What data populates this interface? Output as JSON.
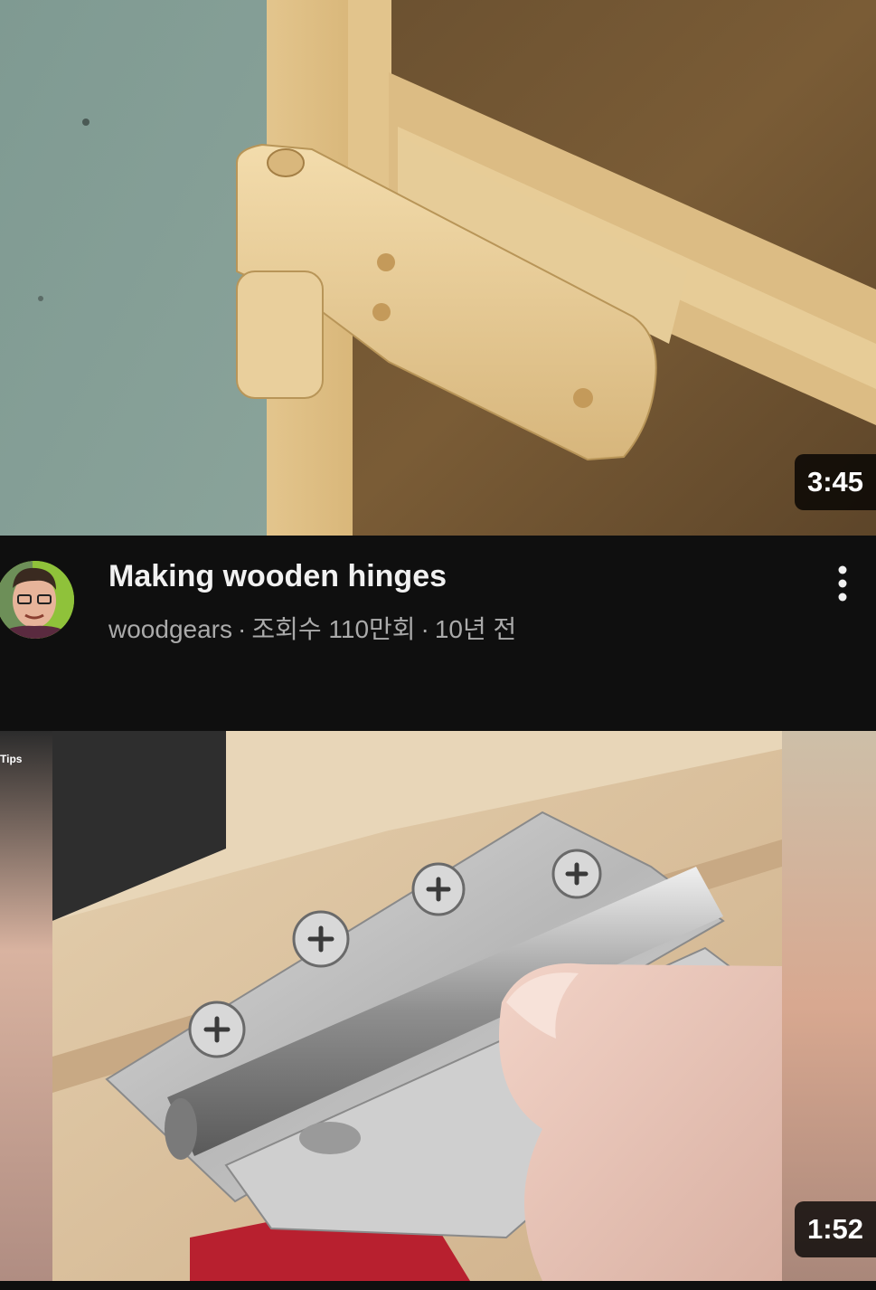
{
  "videos": [
    {
      "title": "Making wooden hinges",
      "channel": "woodgears",
      "views": "조회수 110만회",
      "age": "10년 전",
      "separator": "·",
      "duration": "3:45"
    },
    {
      "side_label": "Tips",
      "duration": "1:52"
    }
  ],
  "icons": {
    "more": "more-vert-icon",
    "avatar": "channel-avatar"
  },
  "colors": {
    "background": "#0f0f0f",
    "title_text": "#f1f1f1",
    "secondary_text": "#aaaaaa",
    "duration_badge": "#000000"
  }
}
